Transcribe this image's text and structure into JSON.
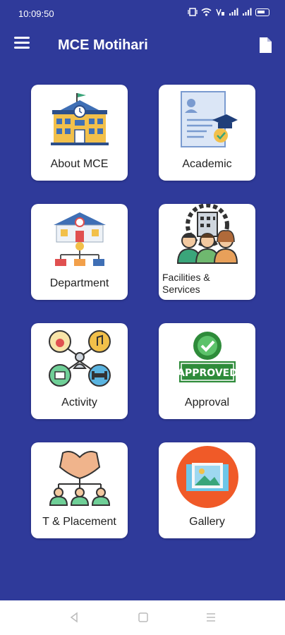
{
  "status_bar": {
    "time": "10:09:50",
    "battery": "83"
  },
  "app_bar": {
    "title": "MCE Motihari",
    "menu_icon": "hamburger-menu-icon",
    "action_icon": "document-icon"
  },
  "tiles": [
    {
      "label": "About MCE",
      "icon": "college-building-icon"
    },
    {
      "label": "Academic",
      "icon": "certificate-graduation-icon"
    },
    {
      "label": "Department",
      "icon": "department-hierarchy-icon"
    },
    {
      "label": "Facilities & Services",
      "icon": "facilities-people-icon"
    },
    {
      "label": "Activity",
      "icon": "activities-icon"
    },
    {
      "label": "Approval",
      "icon": "approved-stamp-icon"
    },
    {
      "label": "T & Placement",
      "icon": "training-placement-icon"
    },
    {
      "label": "Gallery",
      "icon": "gallery-image-icon"
    }
  ],
  "colors": {
    "background": "#2f3a9a",
    "card": "#ffffff",
    "nav_bar": "#ffffff"
  },
  "nav_bar": {
    "back_icon": "back-triangle-icon",
    "home_icon": "home-square-icon",
    "recents_icon": "recents-lines-icon"
  }
}
